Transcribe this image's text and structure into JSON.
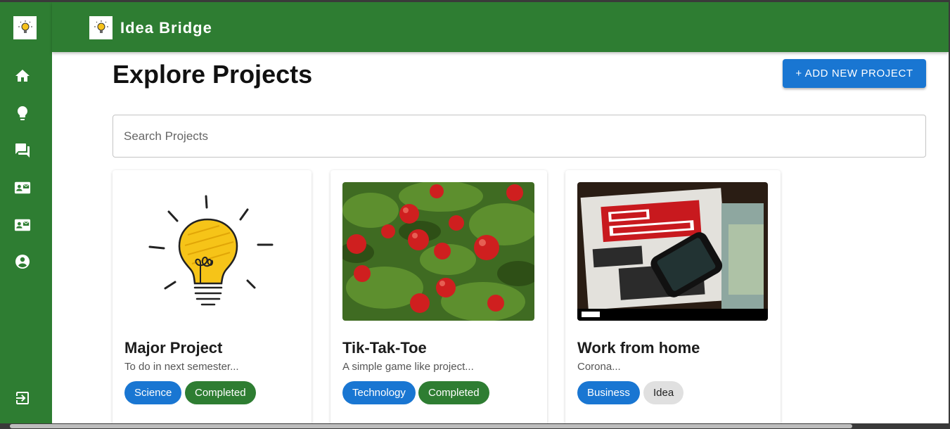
{
  "app": {
    "title": "Idea Bridge"
  },
  "sidebar": {
    "items": [
      {
        "icon": "home-icon"
      },
      {
        "icon": "lightbulb-icon"
      },
      {
        "icon": "forum-icon"
      },
      {
        "icon": "contact-mail-icon"
      },
      {
        "icon": "contact-mail-icon"
      },
      {
        "icon": "account-circle-icon"
      }
    ],
    "logout_icon": "logout-icon"
  },
  "page": {
    "title": "Explore Projects",
    "add_button": "+ ADD NEW PROJECT"
  },
  "search": {
    "placeholder": "Search Projects",
    "value": ""
  },
  "projects": [
    {
      "title": "Major Project",
      "description": "To do in next semester...",
      "tags": [
        "Science",
        "Completed"
      ]
    },
    {
      "title": "Tik-Tak-Toe",
      "description": "A simple game like project...",
      "tags": [
        "Technology",
        "Completed"
      ]
    },
    {
      "title": "Work from home",
      "description": "Corona...",
      "tags": [
        "Business",
        "Idea"
      ]
    }
  ],
  "colors": {
    "primary_green": "#2e7d32",
    "primary_blue": "#1976d2",
    "chip_grey": "#e0e0e0"
  }
}
